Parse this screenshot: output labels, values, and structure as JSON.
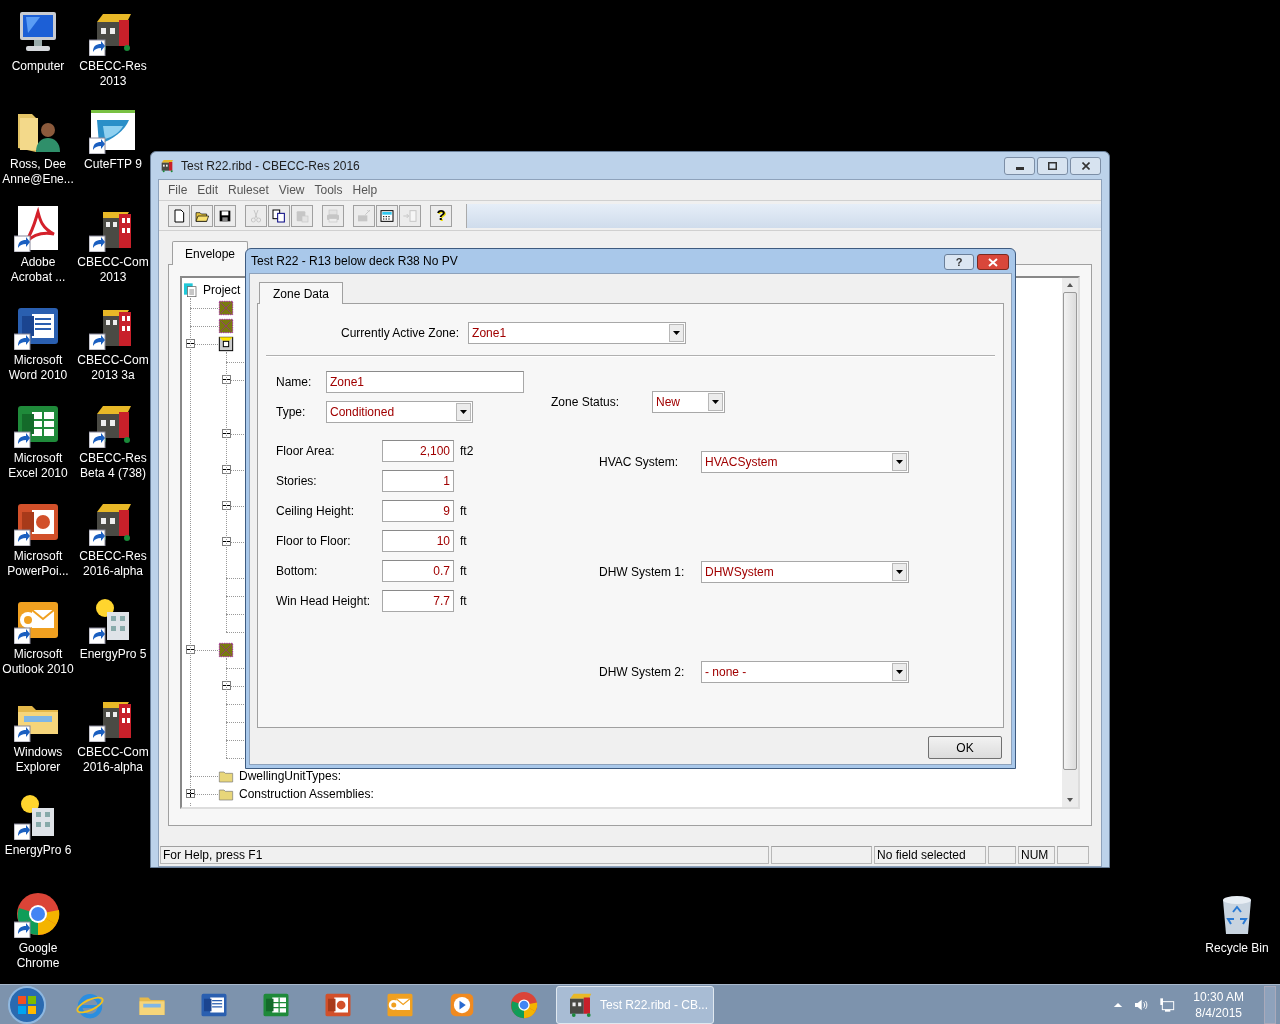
{
  "desktop_icons": [
    {
      "label": "Computer",
      "kind": "computer",
      "shortcut": false
    },
    {
      "label": "CBECC-Res 2013",
      "kind": "building-res",
      "shortcut": true
    },
    {
      "label": "Ross, Dee Anne@Ene...",
      "kind": "user-folder",
      "shortcut": false
    },
    {
      "label": "CuteFTP 9",
      "kind": "ftp",
      "shortcut": true
    },
    {
      "label": "Adobe Acrobat ...",
      "kind": "pdf",
      "shortcut": true
    },
    {
      "label": "CBECC-Com 2013",
      "kind": "building-com",
      "shortcut": true
    },
    {
      "label": "Microsoft Word 2010",
      "kind": "word",
      "shortcut": true
    },
    {
      "label": "CBECC-Com 2013 3a",
      "kind": "building-com",
      "shortcut": true
    },
    {
      "label": "Microsoft Excel 2010",
      "kind": "excel",
      "shortcut": true
    },
    {
      "label": "CBECC-Res Beta 4 (738)",
      "kind": "building-res",
      "shortcut": true
    },
    {
      "label": "Microsoft PowerPoi...",
      "kind": "powerpoint",
      "shortcut": true
    },
    {
      "label": "CBECC-Res 2016-alpha",
      "kind": "building-res",
      "shortcut": true
    },
    {
      "label": "Microsoft Outlook 2010",
      "kind": "outlook",
      "shortcut": true
    },
    {
      "label": "EnergyPro 5",
      "kind": "energypro",
      "shortcut": true
    },
    {
      "label": "Windows Explorer",
      "kind": "explorer",
      "shortcut": true
    },
    {
      "label": "CBECC-Com 2016-alpha",
      "kind": "building-com",
      "shortcut": true
    },
    {
      "label": "EnergyPro 6",
      "kind": "energypro",
      "shortcut": true
    },
    {
      "label": "Google Chrome",
      "kind": "chrome",
      "shortcut": true
    },
    {
      "label": "Recycle Bin",
      "kind": "recycle",
      "shortcut": false
    }
  ],
  "window": {
    "title": "Test R22.ribd - CBECC-Res 2016",
    "menu": [
      "File",
      "Edit",
      "Ruleset",
      "View",
      "Tools",
      "Help"
    ],
    "toolbar": [
      {
        "kind": "new",
        "disabled": false
      },
      {
        "kind": "open",
        "disabled": false
      },
      {
        "kind": "save",
        "disabled": false
      },
      {
        "kind": "cut",
        "disabled": true
      },
      {
        "kind": "copy",
        "disabled": false
      },
      {
        "kind": "paste",
        "disabled": true
      },
      {
        "kind": "print",
        "disabled": true
      },
      {
        "kind": "wand",
        "disabled": true
      },
      {
        "kind": "calculator",
        "disabled": false
      },
      {
        "kind": "import",
        "disabled": true
      },
      {
        "kind": "help",
        "label": "?",
        "disabled": false
      }
    ],
    "tabs": [
      {
        "label": "Envelope",
        "selected": true
      }
    ],
    "tree": {
      "label": "Project",
      "children": [
        {
          "kind": "component"
        },
        {
          "kind": "component"
        },
        {
          "kind": "zone",
          "expanded": true,
          "children": [
            {
              "kind": "leaf"
            },
            {
              "kind": "branch",
              "expanded": true
            },
            {
              "kind": "branch",
              "expanded": true
            },
            {
              "kind": "branch",
              "expanded": true
            },
            {
              "kind": "branch",
              "expanded": true
            },
            {
              "kind": "branch",
              "expanded": true
            },
            {
              "kind": "leaf"
            },
            {
              "kind": "leaf"
            },
            {
              "kind": "leaf"
            },
            {
              "kind": "leaf"
            }
          ]
        },
        {
          "kind": "component",
          "expanded": true,
          "children": [
            {
              "kind": "leaf"
            },
            {
              "kind": "branch",
              "expanded": true
            },
            {
              "kind": "leaf"
            },
            {
              "kind": "leaf"
            },
            {
              "kind": "leaf"
            },
            {
              "kind": "leaf"
            }
          ]
        },
        {
          "label": "DwellingUnitTypes:",
          "kind": "folder"
        },
        {
          "label": "Construction Assemblies:",
          "kind": "folder",
          "expanded": false
        }
      ]
    },
    "status_bar": {
      "help": "For Help, press F1",
      "field": "No field selected",
      "num": "NUM"
    }
  },
  "dialog": {
    "title": "Test R22 - R13 below deck R38 No PV",
    "help_button": "?",
    "tabs": [
      {
        "label": "Zone Data",
        "selected": true
      }
    ],
    "active_zone": {
      "label": "Currently Active Zone:",
      "value": "Zone1"
    },
    "left_fields": [
      {
        "label": "Name:",
        "value": "Zone1",
        "kind": "text"
      },
      {
        "label": "Type:",
        "value": "Conditioned",
        "kind": "combo"
      },
      {
        "label": "Floor Area:",
        "value": "2,100",
        "unit": "ft2",
        "kind": "number"
      },
      {
        "label": "Stories:",
        "value": "1",
        "kind": "number"
      },
      {
        "label": "Ceiling Height:",
        "value": "9",
        "unit": "ft",
        "kind": "number"
      },
      {
        "label": "Floor to Floor:",
        "value": "10",
        "unit": "ft",
        "kind": "number"
      },
      {
        "label": "Bottom:",
        "value": "0.7",
        "unit": "ft",
        "kind": "number"
      },
      {
        "label": "Win Head Height:",
        "value": "7.7",
        "unit": "ft",
        "kind": "number"
      }
    ],
    "right_fields": [
      {
        "label": "Zone Status:",
        "value": "New",
        "kind": "small-combo"
      },
      {
        "label": "HVAC System:",
        "value": "HVACSystem",
        "kind": "combo"
      },
      {
        "label": "DHW System 1:",
        "value": "DHWSystem",
        "kind": "combo"
      },
      {
        "label": "DHW System 2:",
        "value": "- none -",
        "kind": "combo"
      }
    ],
    "ok_button": "OK"
  },
  "taskbar": {
    "apps": [
      {
        "kind": "ie"
      },
      {
        "kind": "explorer"
      },
      {
        "kind": "word"
      },
      {
        "kind": "excel"
      },
      {
        "kind": "powerpoint"
      },
      {
        "kind": "outlook"
      },
      {
        "kind": "media"
      },
      {
        "kind": "chrome"
      }
    ],
    "active_task": {
      "label": "Test R22.ribd - CB...",
      "selected": true
    },
    "time": "10:30 AM",
    "date": "8/4/2015"
  }
}
